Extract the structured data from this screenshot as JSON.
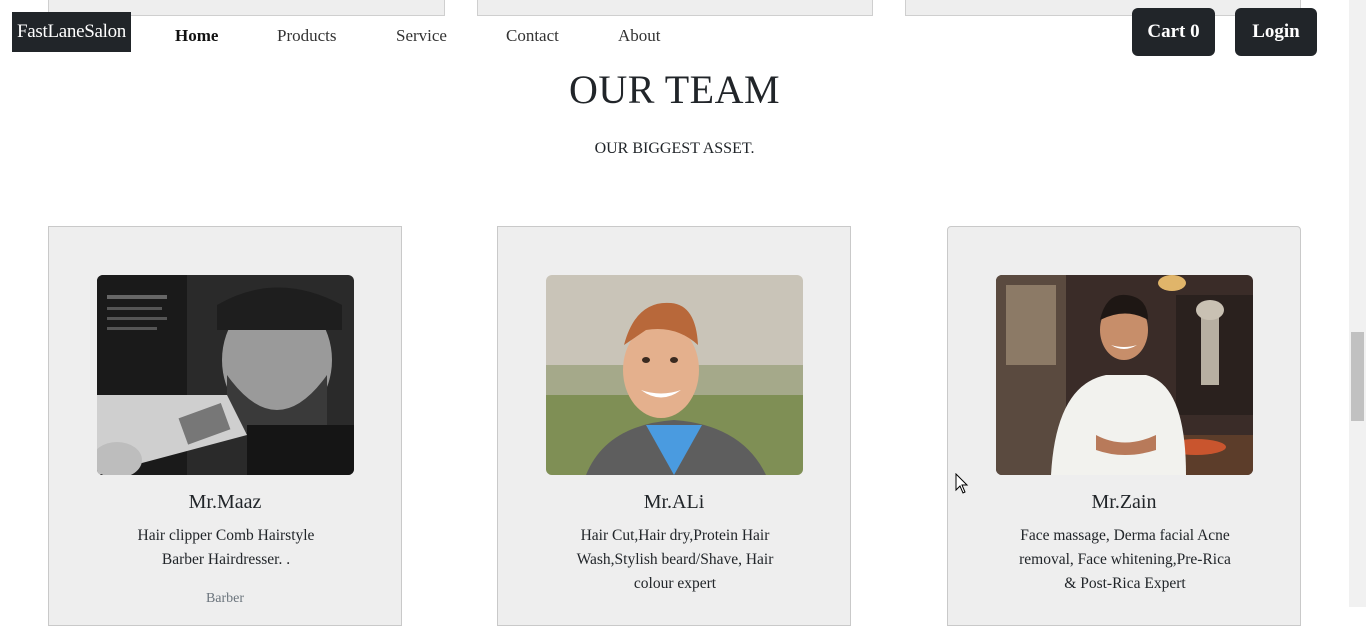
{
  "header": {
    "brand": "FastLaneSalon",
    "nav": [
      "Home",
      "Products",
      "Service",
      "Contact",
      "About"
    ],
    "active_nav": "Home",
    "cart_label": "Cart 0",
    "login_label": "Login"
  },
  "section": {
    "title": "OUR TEAM",
    "subtitle": "OUR BIGGEST ASSET."
  },
  "team": [
    {
      "name": "Mr.Maaz",
      "description": "Hair clipper Comb Hairstyle Barber Hairdresser. .",
      "role": "Barber"
    },
    {
      "name": "Mr.ALi",
      "description": "Hair Cut,Hair dry,Protein Hair Wash,Stylish beard/Shave, Hair colour expert",
      "role": ""
    },
    {
      "name": "Mr.Zain",
      "description": "Face massage, Derma facial Acne removal, Face whitening,Pre-Rica & Post-Rica Expert",
      "role": ""
    }
  ],
  "colors": {
    "dark": "#212529",
    "card_bg": "#eeeeee",
    "muted": "#6c757d"
  }
}
